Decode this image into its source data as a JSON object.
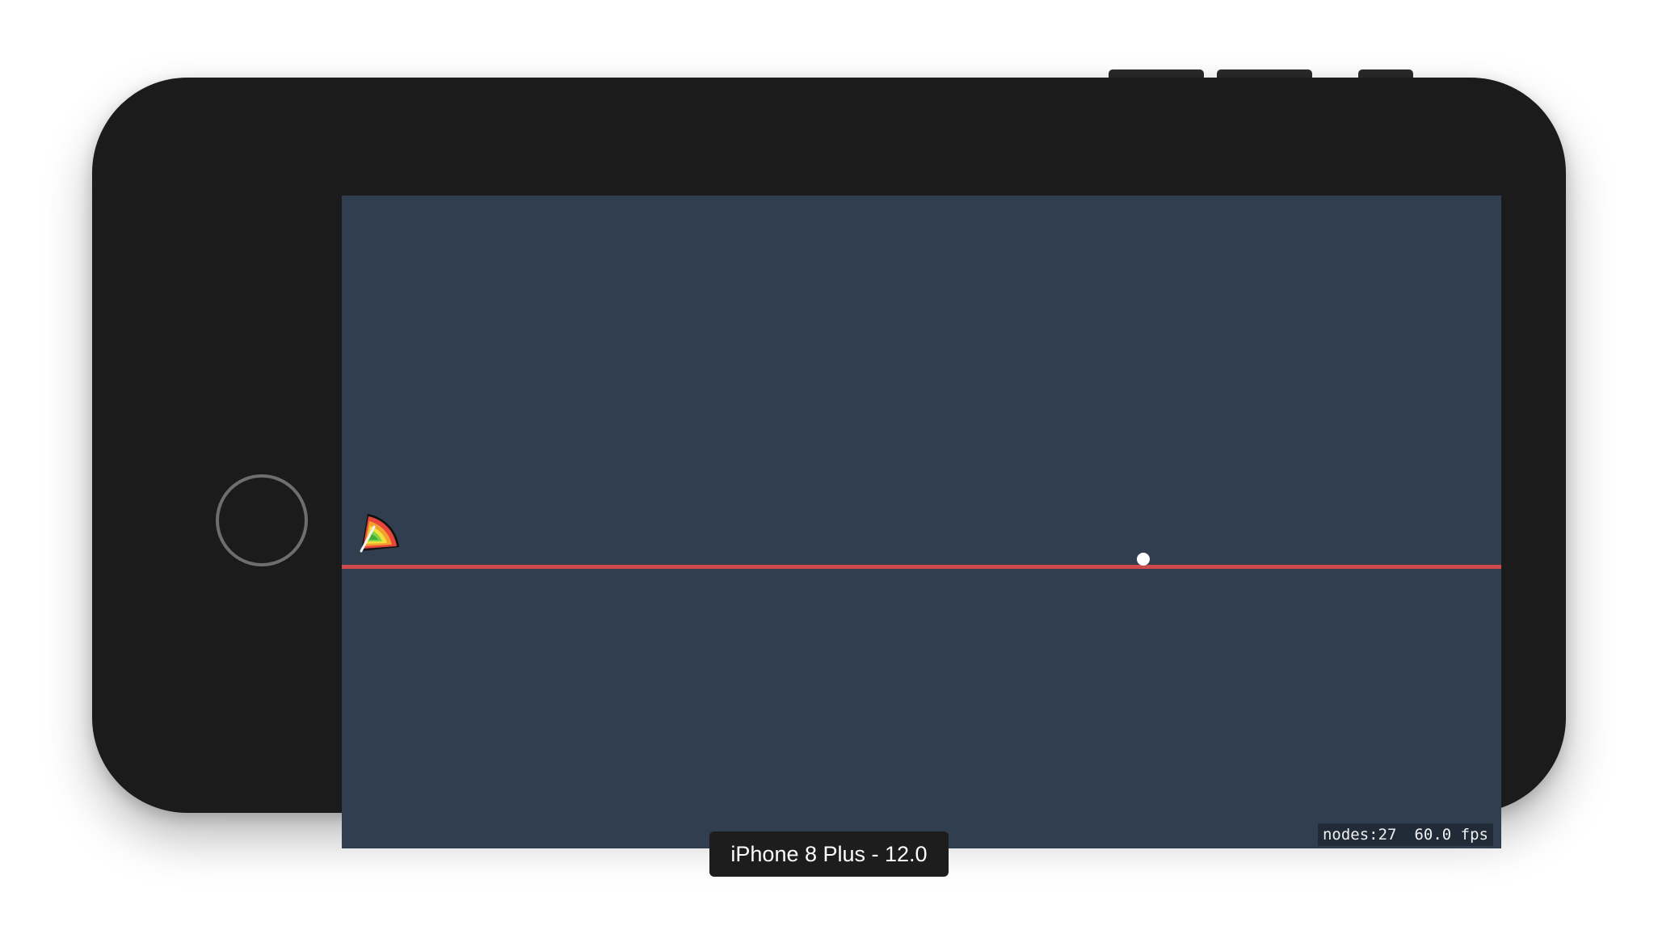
{
  "device": {
    "label": "iPhone 8 Plus - 12.0"
  },
  "scene": {
    "background_color": "#313e4f",
    "ground_line_color": "#cf4a4c",
    "ball_color": "#ffffff",
    "launcher_icon": "power-meter-icon",
    "launcher_colors": [
      "#e8453c",
      "#f4a02e",
      "#f2e03a",
      "#7fd34a",
      "#3fae3a"
    ]
  },
  "stats": {
    "nodes": "nodes:27",
    "fps": "60.0 fps"
  }
}
